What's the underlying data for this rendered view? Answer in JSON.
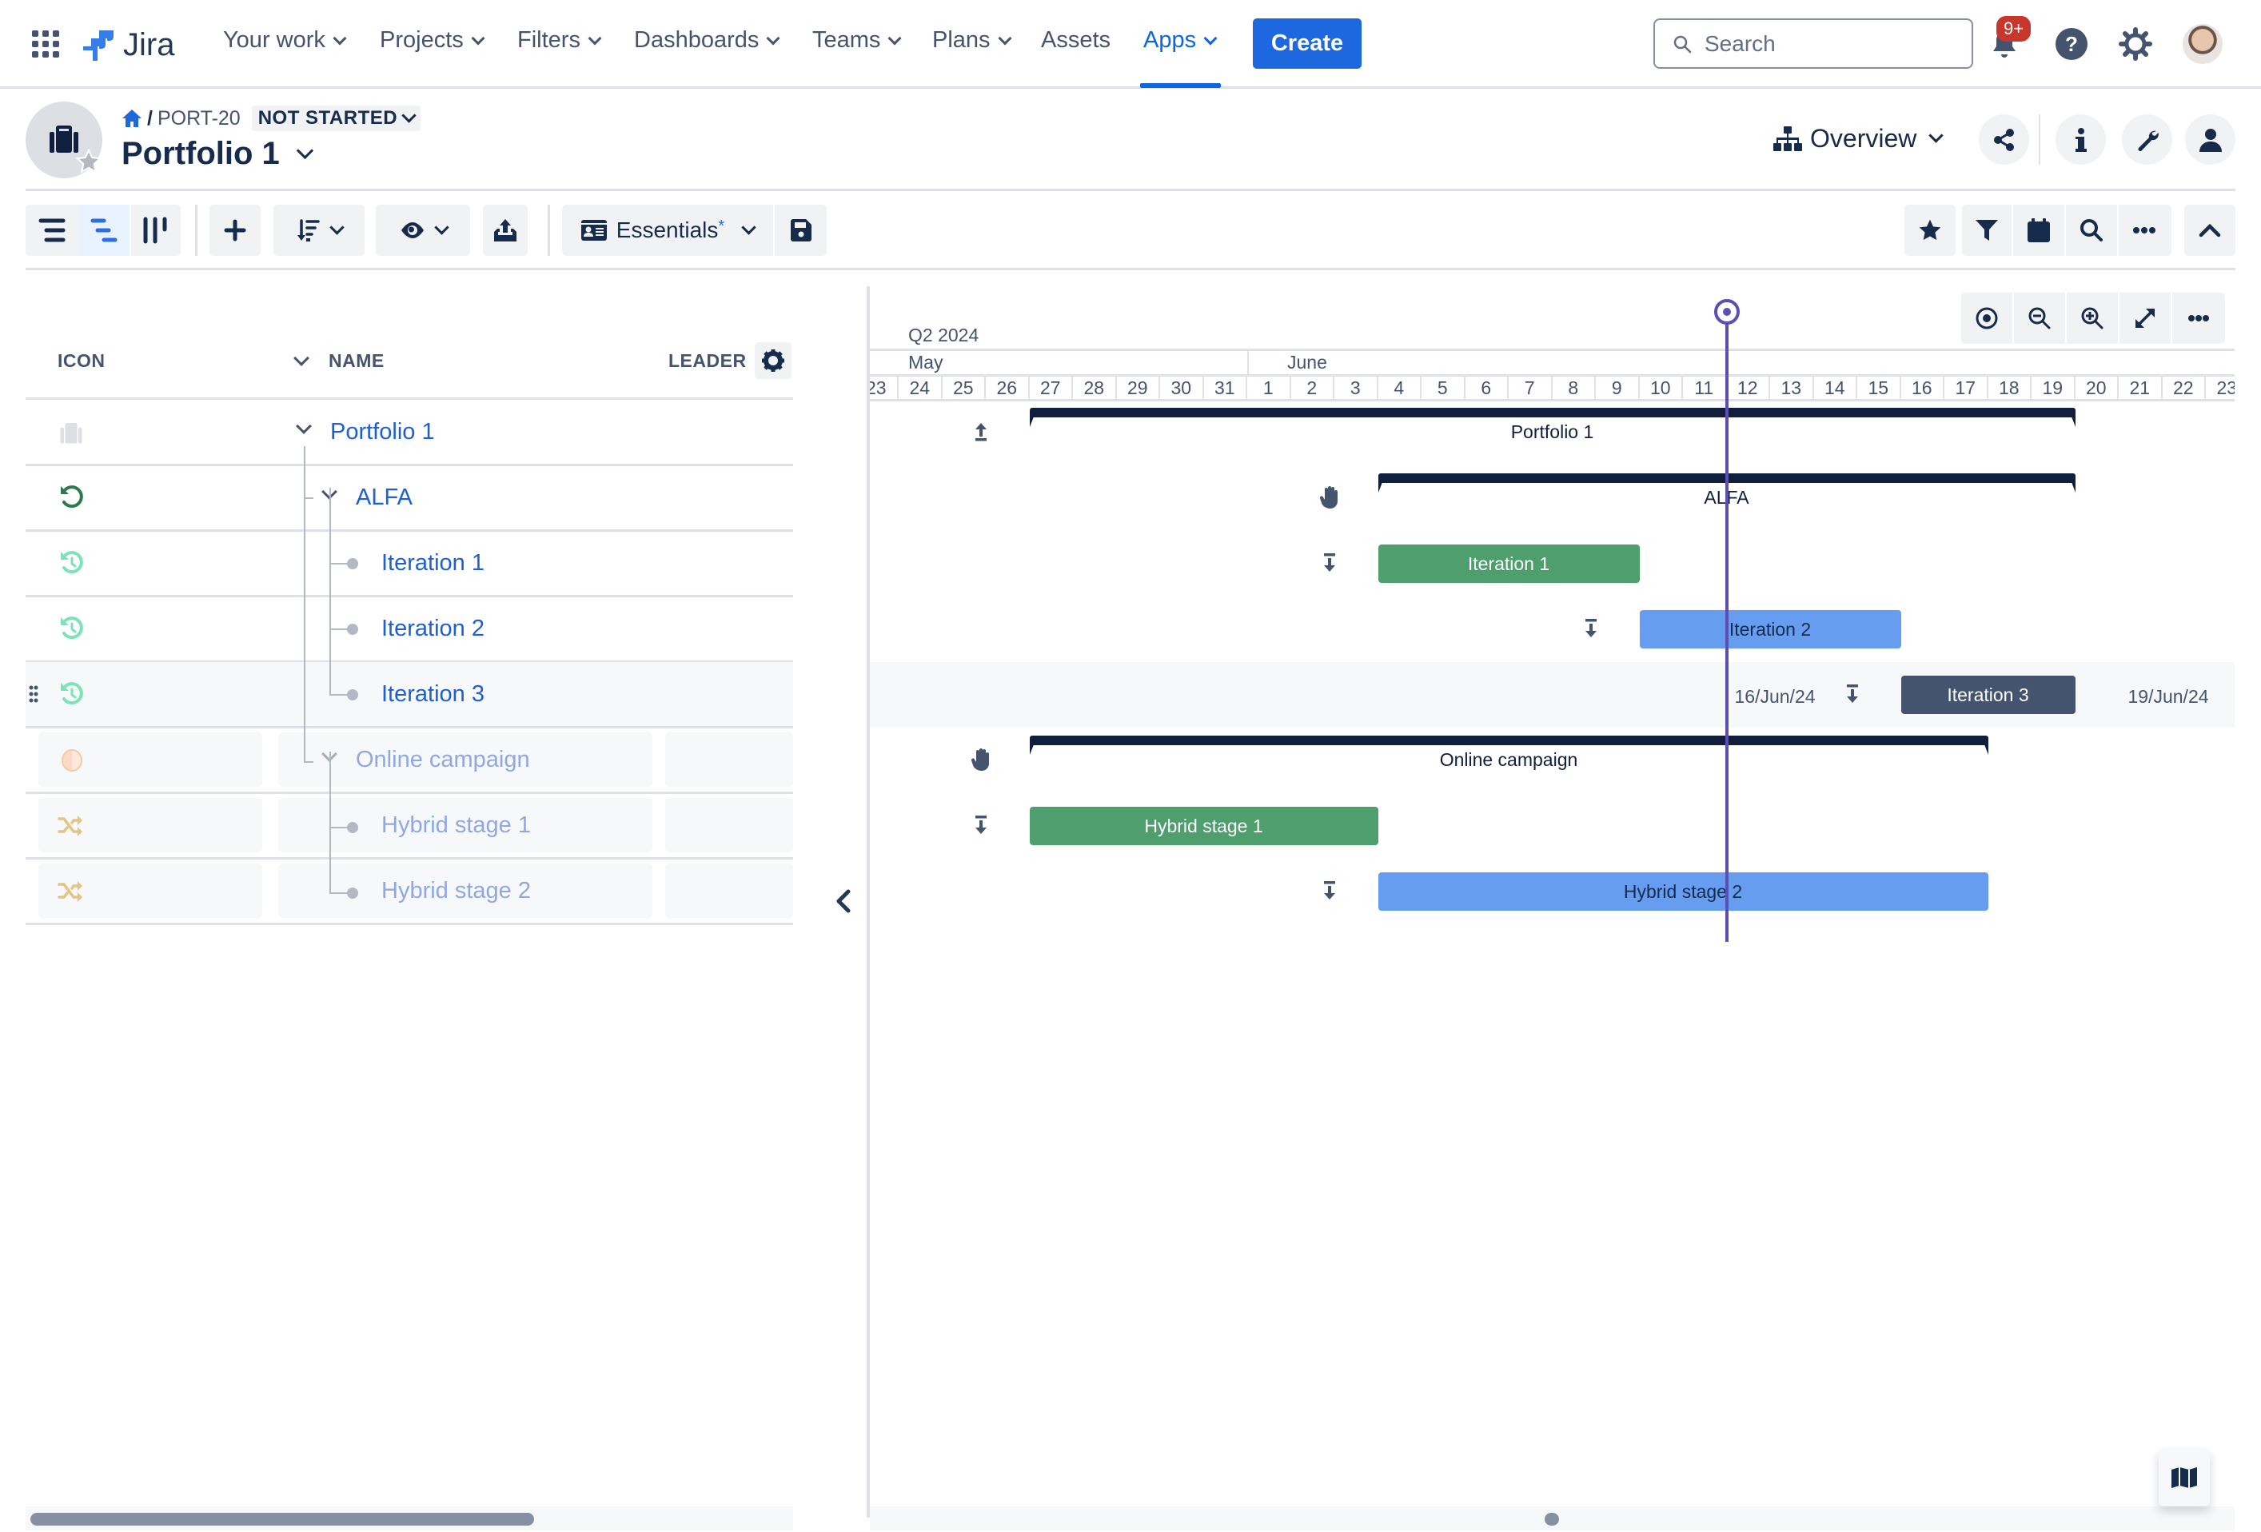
{
  "topnav": {
    "app_name": "Jira",
    "items": [
      {
        "label": "Your work",
        "has_dropdown": true
      },
      {
        "label": "Projects",
        "has_dropdown": true
      },
      {
        "label": "Filters",
        "has_dropdown": true
      },
      {
        "label": "Dashboards",
        "has_dropdown": true
      },
      {
        "label": "Teams",
        "has_dropdown": true
      },
      {
        "label": "Plans",
        "has_dropdown": true
      },
      {
        "label": "Assets",
        "has_dropdown": false
      },
      {
        "label": "Apps",
        "has_dropdown": true,
        "active": true
      }
    ],
    "create_label": "Create",
    "search_placeholder": "Search",
    "notifications_badge": "9+",
    "accent_color": "#1d68de"
  },
  "header": {
    "breadcrumb_separator": "/",
    "issue_key": "PORT-20",
    "status": "NOT STARTED",
    "title": "Portfolio 1",
    "view_selector": "Overview"
  },
  "toolbar": {
    "view_buttons": [
      "list-view",
      "gantt-view",
      "board-view"
    ],
    "selected_view": "gantt-view",
    "preset_label": "Essentials",
    "preset_modified_marker": "*"
  },
  "table": {
    "columns": [
      "ICON",
      "NAME",
      "LEADER"
    ],
    "rows": [
      {
        "name": "Portfolio 1",
        "icon": "briefcase-icon",
        "level": 0,
        "expandable": true,
        "dimmed": false
      },
      {
        "name": "ALFA",
        "icon": "cycle-icon",
        "level": 1,
        "expandable": true,
        "dimmed": false
      },
      {
        "name": "Iteration 1",
        "icon": "history-icon",
        "level": 2,
        "expandable": false,
        "dimmed": false
      },
      {
        "name": "Iteration 2",
        "icon": "history-icon",
        "level": 2,
        "expandable": false,
        "dimmed": false
      },
      {
        "name": "Iteration 3",
        "icon": "history-icon",
        "level": 2,
        "expandable": false,
        "dimmed": false,
        "hovered": true
      },
      {
        "name": "Online campaign",
        "icon": "half-circle-icon",
        "level": 1,
        "expandable": true,
        "dimmed": true
      },
      {
        "name": "Hybrid stage 1",
        "icon": "shuffle-icon",
        "level": 2,
        "expandable": false,
        "dimmed": true
      },
      {
        "name": "Hybrid stage 2",
        "icon": "shuffle-icon",
        "level": 2,
        "expandable": false,
        "dimmed": true
      }
    ]
  },
  "timeline": {
    "quarter": "Q2 2024",
    "months": [
      "May",
      "June"
    ],
    "days": [
      "23",
      "24",
      "25",
      "26",
      "27",
      "28",
      "29",
      "30",
      "31",
      "1",
      "2",
      "3",
      "4",
      "5",
      "6",
      "7",
      "8",
      "9",
      "10",
      "11",
      "12",
      "13",
      "14",
      "15",
      "16",
      "17",
      "18",
      "19",
      "20",
      "21",
      "22",
      "23"
    ],
    "today": "2024-06-12",
    "bars": [
      {
        "label": "Portfolio 1",
        "type": "bracket",
        "start": "2024-05-27",
        "end": "2024-06-19",
        "lead_icon": "upload-arrow-icon"
      },
      {
        "label": "ALFA",
        "type": "bracket",
        "start": "2024-06-04",
        "end": "2024-06-19",
        "lead_icon": "hand-icon"
      },
      {
        "label": "Iteration 1",
        "type": "bar",
        "color": "#4f9e6d",
        "text_color": "#ffffff",
        "start": "2024-06-04",
        "end": "2024-06-09",
        "lead_icon": "download-arrow-icon"
      },
      {
        "label": "Iteration 2",
        "type": "bar",
        "color": "#669df1",
        "text_color": "#172b4d",
        "start": "2024-06-10",
        "end": "2024-06-15",
        "lead_icon": "download-arrow-icon"
      },
      {
        "label": "Iteration 3",
        "type": "bar",
        "color": "#44546f",
        "text_color": "#ffffff",
        "start": "2024-06-16",
        "end": "2024-06-19",
        "lead_icon": "download-arrow-icon",
        "start_label": "16/Jun/24",
        "end_label": "19/Jun/24"
      },
      {
        "label": "Online campaign",
        "type": "bracket",
        "start": "2024-05-27",
        "end": "2024-06-17",
        "lead_icon": "hand-icon"
      },
      {
        "label": "Hybrid stage 1",
        "type": "bar",
        "color": "#4f9e6d",
        "text_color": "#ffffff",
        "start": "2024-05-27",
        "end": "2024-06-03",
        "lead_icon": "download-arrow-icon"
      },
      {
        "label": "Hybrid stage 2",
        "type": "bar",
        "color": "#669df1",
        "text_color": "#172b4d",
        "start": "2024-06-04",
        "end": "2024-06-17",
        "lead_icon": "download-arrow-icon"
      }
    ]
  },
  "scroll": {
    "left_table_position": 0,
    "gantt_position": 0.5
  }
}
